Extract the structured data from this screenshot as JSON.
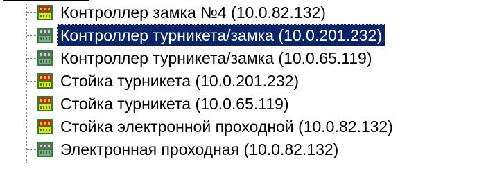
{
  "tree": {
    "top_label": "",
    "nodes": [
      {
        "label": "Контроллер замка №4 (10.0.82.132)",
        "icon": "controller-red-icon",
        "selected": false
      },
      {
        "label": "Контроллер турникета/замка (10.0.201.232)",
        "icon": "controller-gray-icon",
        "selected": true
      },
      {
        "label": "Контроллер турникета/замка (10.0.65.119)",
        "icon": "controller-gray-icon",
        "selected": false
      },
      {
        "label": "Стойка турникета (10.0.201.232)",
        "icon": "controller-red-icon",
        "selected": false
      },
      {
        "label": "Стойка турникета (10.0.65.119)",
        "icon": "controller-red-icon",
        "selected": false
      },
      {
        "label": "Стойка электронной проходной (10.0.82.132)",
        "icon": "controller-red-icon",
        "selected": false
      },
      {
        "label": "Электронная проходная (10.0.82.132)",
        "icon": "controller-gray-icon",
        "selected": false
      }
    ]
  },
  "colors": {
    "selection_bg": "#0a246a",
    "selection_text": "#ffffff",
    "connector": "#808080",
    "icon_red_top": "#d42020",
    "icon_yellow": "#ffd800",
    "icon_gray_top": "#6a6a6a",
    "icon_green": "#1f8a2a"
  }
}
